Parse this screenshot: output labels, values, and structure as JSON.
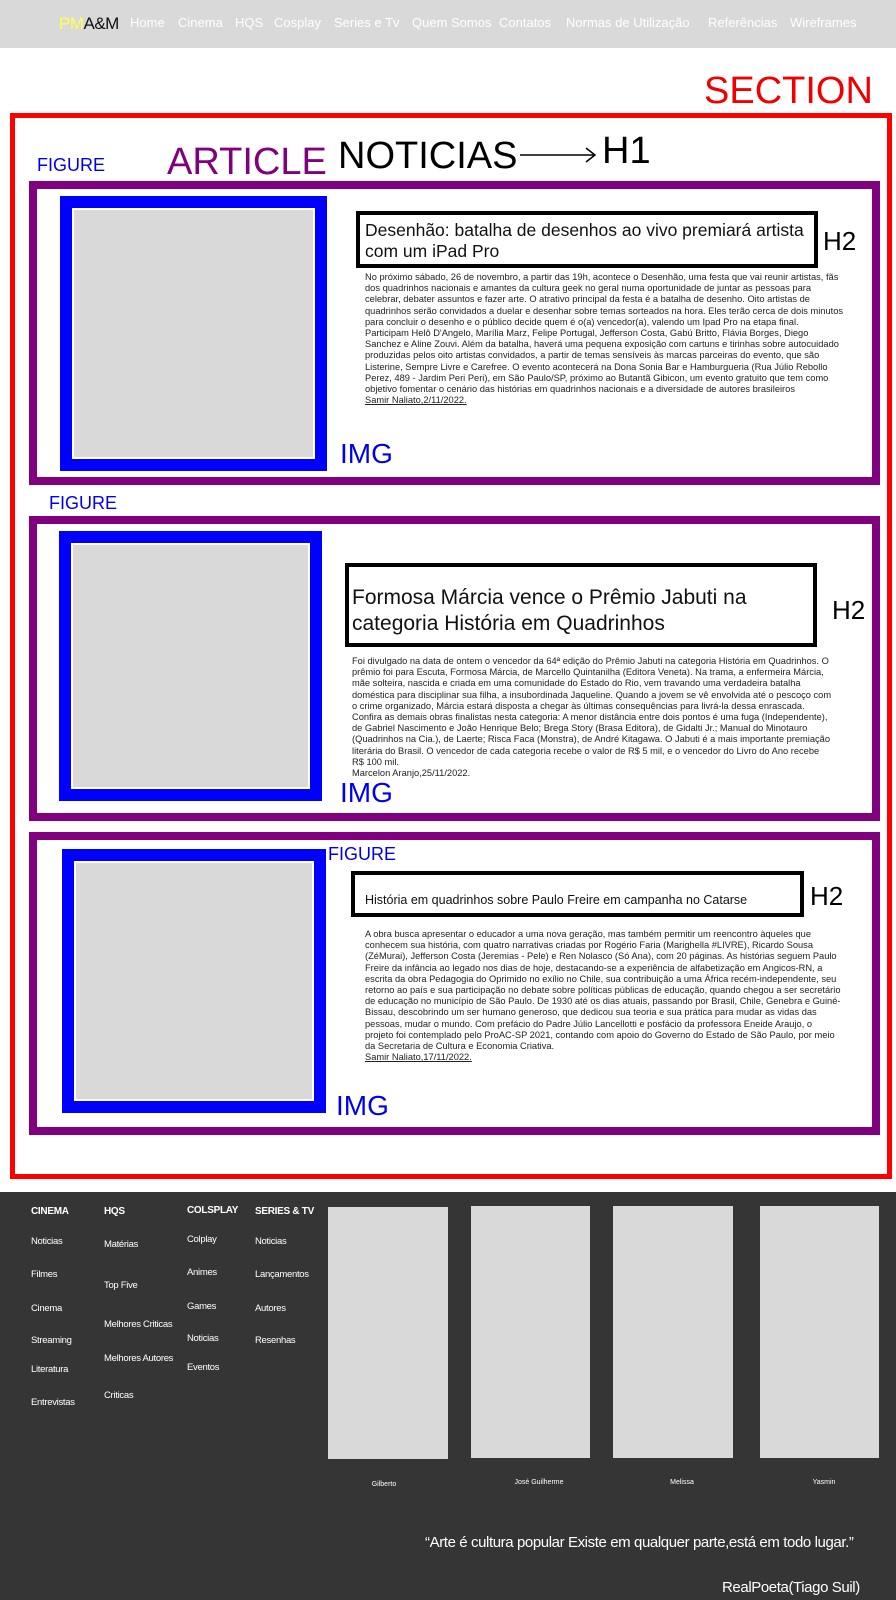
{
  "nav": {
    "logo_pm": "PM",
    "logo_am": "A&M",
    "items": [
      "Home",
      "Cinema",
      "HQS",
      "Cosplay",
      "Series e Tv",
      "Quem Somos",
      "Contatos",
      "Normas de Utilização",
      "Referências",
      "Wireframes"
    ]
  },
  "labels": {
    "section": "SECTION",
    "figure": "FIGURE",
    "article": "ARTICLE",
    "noticias": "NOTICIAS",
    "h1": "H1",
    "h2": "H2",
    "img": "IMG"
  },
  "articles": [
    {
      "title": "Desenhão: batalha de desenhos ao vivo premiará artista com um iPad Pro",
      "body": "No próximo sábado, 26 de novembro, a partir das 19h, acontece o Desenhão, uma festa que vai reunir artistas, fãs dos quadrinhos nacionais e amantes da cultura geek no geral numa oportunidade de juntar as pessoas para celebrar, debater assuntos e fazer arte. O atrativo principal da festa é a batalha de desenho. Oito artistas de quadrinhos serão convidados a duelar e desenhar sobre temas sorteados na hora. Eles terão cerca de dois minutos para concluir o desenho e o público decide quem é o(a) vencedor(a), valendo um Ipad Pro na etapa final. Participam Helô D'Angelo, Marília Marz, Felipe Portugal, Jefferson Costa, Gabú Britto, Flávia Borges, Diego Sanchez e Aline Zouvi. Além da batalha, haverá uma pequena exposição com cartuns e tirinhas sobre autocuidado produzidas pelos oito artistas convidados, a partir de temas sensíveis às marcas parceiras do evento, que são Listerine, Sempre Livre e Carefree. O evento acontecerá na Dona Sonia Bar e Hamburgueria (Rua Júlio Rebollo Perez, 489 - Jardim Peri Peri), em São Paulo/SP, próximo ao Butantã Gibicon, um evento gratuito que tem como objetivo fomentar o cenário das histórias em quadrinhos nacionais e a diversidade de autores brasileiros",
      "author": "Samir Naliato,2/11/2022."
    },
    {
      "title": "Formosa Márcia vence o Prêmio Jabuti na categoria História em Quadrinhos",
      "body": "Foi divulgado na data de ontem o vencedor da 64ª edição do Prêmio Jabuti na categoria História em Quadrinhos. O prêmio foi para Escuta, Formosa Márcia, de Marcello Quintanilha (Editora Veneta). Na trama, a enfermeira Márcia, mãe solteira, nascida e criada em uma comunidade do Estado do Rio, vem travando uma verdadeira batalha doméstica para disciplinar sua filha, a insubordinada Jaqueline. Quando a jovem se vê envolvida até o pescoço com o crime organizado, Márcia estará disposta a chegar às últimas consequências para livrá-la dessa enrascada. Confira as demais obras finalistas nesta categoria: A menor distância entre dois pontos é uma fuga (Independente), de Gabriel Nascimento e João Henrique Belo; Brega Story (Brasa Editora), de Gidalti Jr.; Manual do Minotauro (Quadrinhos na Cia.), de Laerte; Risca Faca (Monstra), de André Kitagawa. O Jabuti é a mais importante premiação literária do Brasil. O vencedor de cada categoria recebe o valor de R$ 5 mil, e o vencedor do Livro do Ano recebe R$ 100 mil.",
      "author": "Marcelon Aranjo,25/11/2022."
    },
    {
      "title": "História em quadrinhos sobre Paulo Freire em campanha no Catarse",
      "body": "A obra busca apresentar o educador a uma nova geração, mas também permitir um reencontro àqueles que conhecem sua história, com quatro narrativas criadas por Rogério Faria (Marighella #LIVRE), Ricardo Sousa (ZéMurai), Jefferson Costa (Jeremias - Pele) e Ren Nolasco (Só Ana), com 20 páginas. As histórias seguem Paulo Freire da infância ao legado nos dias de hoje, destacando-se a experiência de alfabetização em Angicos-RN, a escrita da obra Pedagogia do Oprimido no exílio no Chile, sua contribuição a uma África recém-independente, seu retorno ao país e sua participação no debate sobre políticas públicas de educação, quando chegou a ser secretário de educação no município de São Paulo. De 1930 até os dias atuais, passando por Brasil, Chile, Genebra e Guiné-Bissau, descobrindo um ser humano generoso, que dedicou sua teoria e sua prática para mudar as vidas das pessoas, mudar o mundo. Com prefácio do Padre Júlio Lancellotti e posfácio da professora Eneide Araujo, o projeto foi contemplado pelo ProAC-SP 2021, contando com apoio do Governo do Estado de São Paulo, por meio da Secretaria de Cultura e Economia Criativa.",
      "author": "Samir Naliato,17/11/2022."
    }
  ],
  "footer": {
    "columns": [
      {
        "title": "CINEMA",
        "items": [
          "Noticias",
          "Filmes",
          "Cinema",
          "Streaming",
          "Literatura",
          "Entrevistas"
        ]
      },
      {
        "title": "HQS",
        "items": [
          "Matérias",
          "Top Five",
          "Melhores Criticas",
          "Melhores Autores",
          "Criticas"
        ]
      },
      {
        "title": "COLSPLAY",
        "items": [
          "Colplay",
          "Animes",
          "Games",
          "Noticias",
          "Eventos"
        ]
      },
      {
        "title": "SERIES & TV",
        "items": [
          "Noticias",
          "Lançamentos",
          "Autores",
          "Resenhas"
        ]
      }
    ],
    "team": [
      "Gilberto",
      "José Guilherme",
      "Melissa",
      "Yasmin"
    ],
    "quote": "“Arte é cultura popular Existe em qualquer parte,está em todo lugar.”",
    "quote_author": "RealPoeta(Tiago Suil)"
  },
  "colors": {
    "section": "#ff0000",
    "article": "#800080",
    "figure": "#0000ff",
    "nav_bg": "#d9d9d9",
    "footer_bg": "#353535"
  }
}
